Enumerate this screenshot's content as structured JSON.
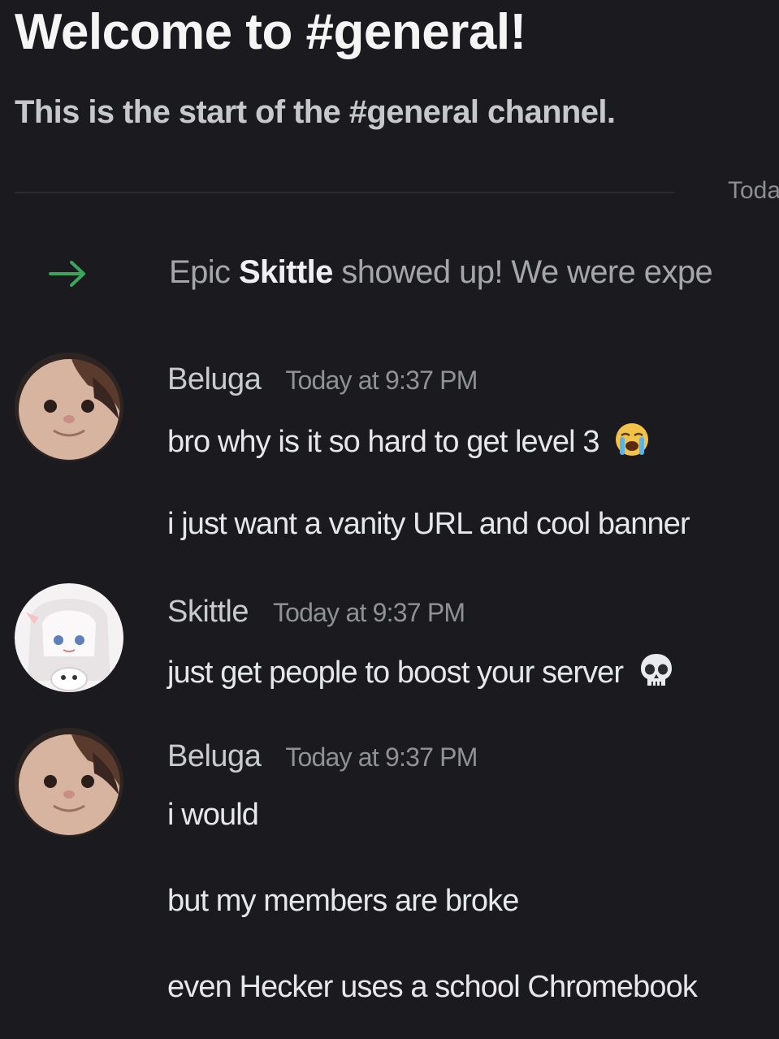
{
  "channel": {
    "welcome_title": "Welcome to #general!",
    "welcome_subtitle": "This is the start of the #general channel.",
    "divider_date": "Toda"
  },
  "join": {
    "prefix": "Epic ",
    "username": "Skittle",
    "suffix": " showed up! We were expe",
    "icon": "arrow-right-icon",
    "icon_color": "#3ba55c"
  },
  "messages": [
    {
      "author": "Beluga",
      "timestamp": "Today at 9:37 PM",
      "lines": [
        "bro why is it so hard to get level 3",
        "i just want a vanity URL and cool banner"
      ],
      "emoji": "loudly-crying-face-icon"
    },
    {
      "author": "Skittle",
      "timestamp": "Today at 9:37 PM",
      "lines": [
        "just get people to boost your server"
      ],
      "emoji": "skull-icon"
    },
    {
      "author": "Beluga",
      "timestamp": "Today at 9:37 PM",
      "lines": [
        "i would",
        "but my members are broke",
        "even Hecker uses a school Chromebook"
      ]
    }
  ]
}
